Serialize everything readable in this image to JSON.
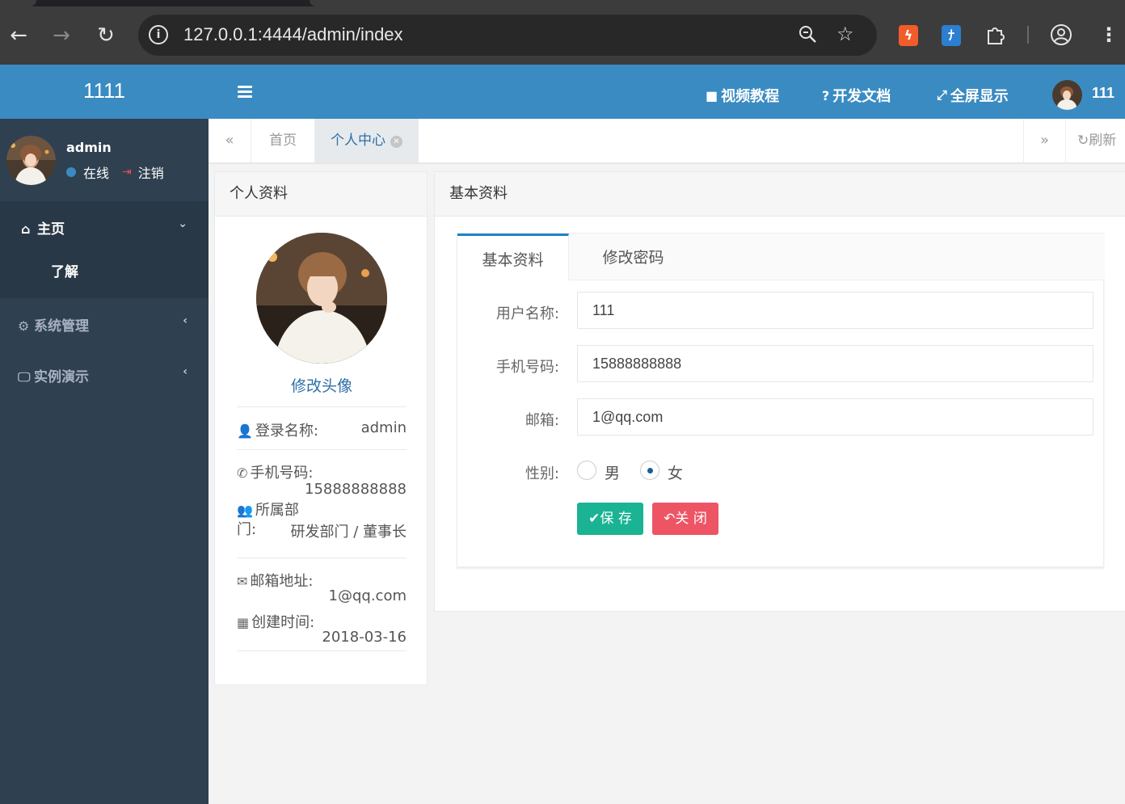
{
  "browser": {
    "url": "127.0.0.1:4444/admin/index"
  },
  "sidebar": {
    "logo_text": "1111",
    "user": {
      "name": "admin",
      "status": "在线",
      "logout": "注销"
    },
    "menu": [
      {
        "label": "主页",
        "icon": "home-icon",
        "expanded": true,
        "children": [
          {
            "label": "了解"
          }
        ]
      },
      {
        "label": "系统管理",
        "icon": "gear-icon",
        "expanded": false
      },
      {
        "label": "实例演示",
        "icon": "desktop-icon",
        "expanded": false
      }
    ]
  },
  "topbar": {
    "video_tutorial": "视频教程",
    "dev_docs": "开发文档",
    "fullscreen": "全屏显示",
    "username": "111"
  },
  "tabs": {
    "items": [
      {
        "label": "首页",
        "active": false
      },
      {
        "label": "个人中心",
        "active": true
      }
    ],
    "refresh": "刷新"
  },
  "profile": {
    "title": "个人资料",
    "change_avatar": "修改头像",
    "rows": [
      {
        "label": "登录名称:",
        "value": "admin",
        "icon": "user-icon"
      },
      {
        "label": "手机号码:",
        "value": "15888888888",
        "icon": "phone-icon"
      },
      {
        "label_line1": "所属部",
        "label_line2": "门:",
        "value": "研发部门 / 董事长",
        "icon": "users-icon"
      },
      {
        "label": "邮箱地址:",
        "value": "1@qq.com",
        "icon": "envelope-icon"
      },
      {
        "label": "创建时间:",
        "value": "2018-03-16",
        "icon": "calendar-icon"
      }
    ]
  },
  "basic": {
    "title": "基本资料",
    "tabs": [
      {
        "label": "基本资料",
        "active": true
      },
      {
        "label": "修改密码",
        "active": false
      }
    ],
    "fields": {
      "username": {
        "label": "用户名称:",
        "value": "111"
      },
      "phone": {
        "label": "手机号码:",
        "value": "15888888888"
      },
      "email": {
        "label": "邮箱:",
        "value": "1@qq.com"
      },
      "gender": {
        "label": "性别:",
        "options": [
          "男",
          "女"
        ],
        "selected": "女"
      }
    },
    "buttons": {
      "save": "保 存",
      "close": "关 闭"
    }
  },
  "colors": {
    "primary": "#3a8bc2",
    "sidebar_bg": "#2f4050",
    "save": "#1ab394",
    "close": "#ed5565"
  }
}
